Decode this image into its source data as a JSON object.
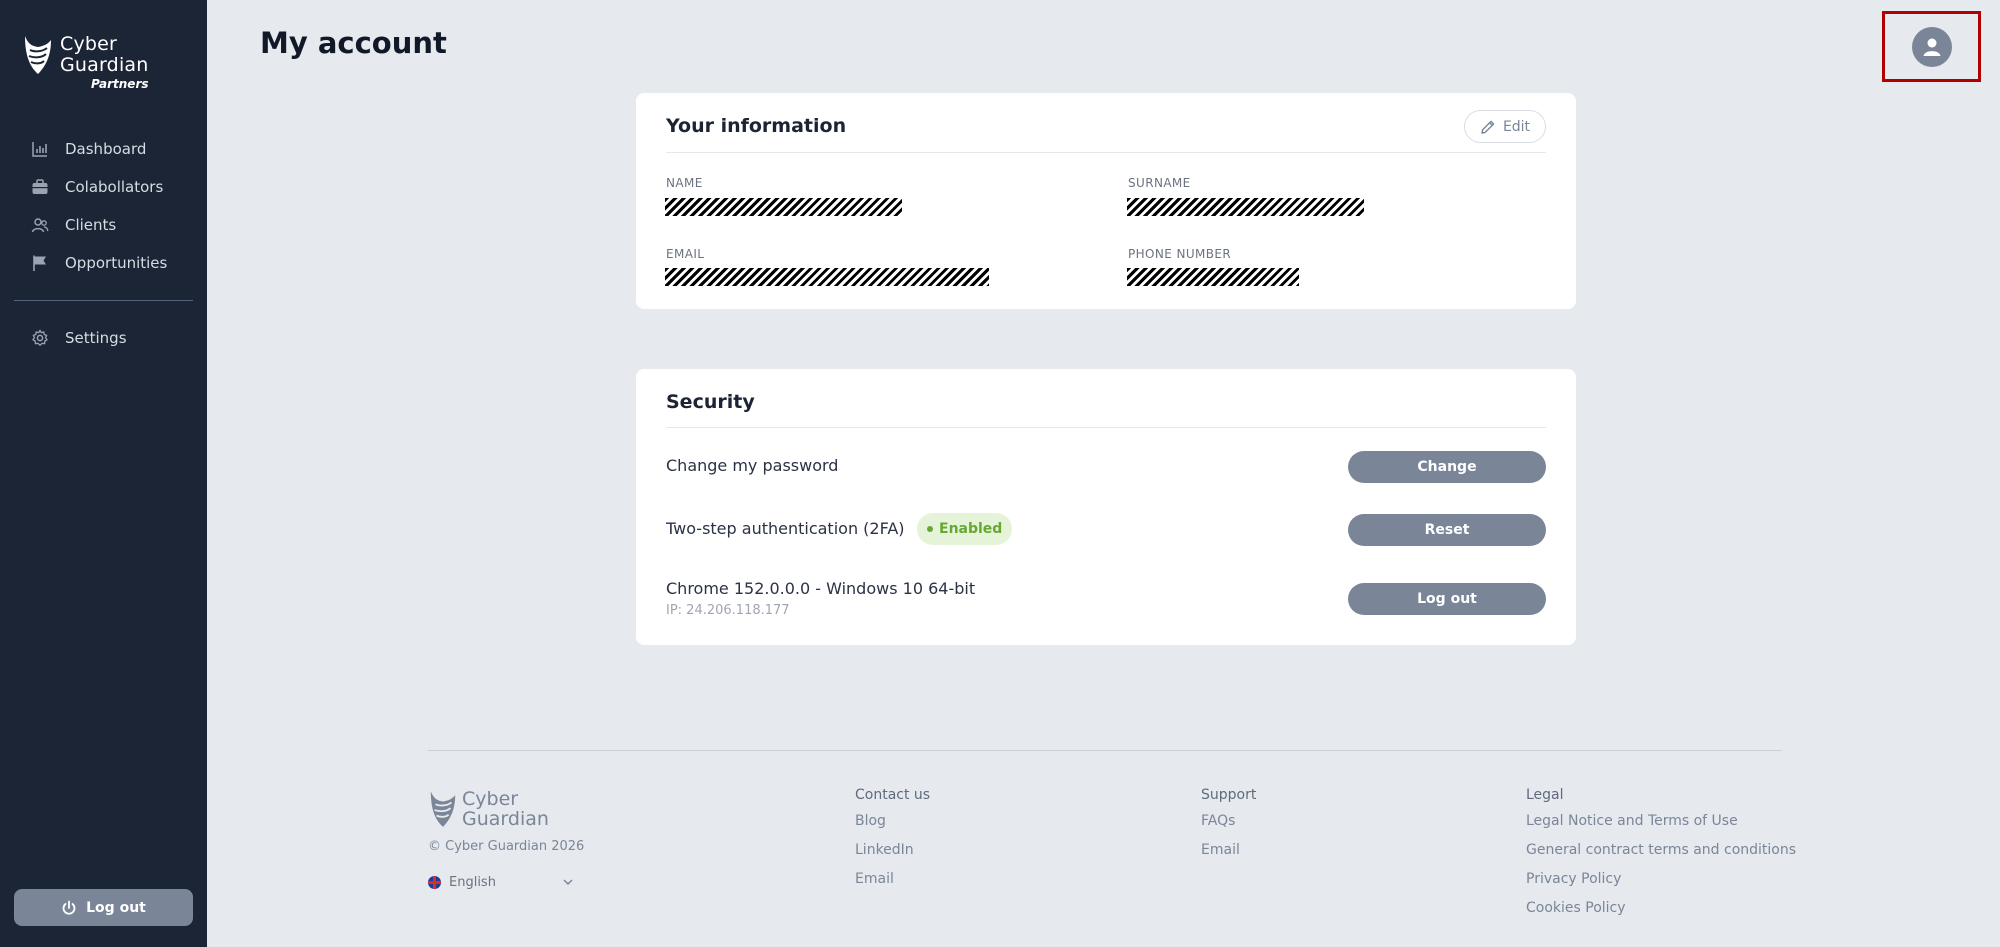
{
  "app": {
    "brand_line1": "Cyber",
    "brand_line2": "Guardian",
    "brand_tag": "Partners"
  },
  "sidebar": {
    "items": [
      {
        "label": "Dashboard",
        "icon": "bar-chart-icon"
      },
      {
        "label": "Colabollators",
        "icon": "briefcase-icon"
      },
      {
        "label": "Clients",
        "icon": "users-icon"
      },
      {
        "label": "Opportunities",
        "icon": "flag-icon"
      }
    ],
    "settings": {
      "label": "Settings",
      "icon": "gear-icon"
    },
    "logout_label": "Log out"
  },
  "header": {
    "title": "My account",
    "avatar_icon": "user-icon"
  },
  "info_card": {
    "title": "Your information",
    "edit_label": "Edit",
    "fields": {
      "name_label": "NAME",
      "surname_label": "SURNAME",
      "email_label": "EMAIL",
      "phone_label": "PHONE NUMBER"
    }
  },
  "security_card": {
    "title": "Security",
    "password": {
      "label": "Change my password",
      "button": "Change"
    },
    "twofa": {
      "label": "Two-step authentication (2FA)",
      "badge": "Enabled",
      "button": "Reset"
    },
    "session": {
      "label": "Chrome 152.0.0.0 - Windows 10 64-bit",
      "ip": "IP: 24.206.118.177",
      "button": "Log out"
    }
  },
  "footer": {
    "brand_line1": "Cyber",
    "brand_line2": "Guardian",
    "copyright": "© Cyber Guardian 2026",
    "language": "English",
    "contact": {
      "heading": "Contact us",
      "links": [
        "Blog",
        "LinkedIn",
        "Email"
      ]
    },
    "support": {
      "heading": "Support",
      "links": [
        "FAQs",
        "Email"
      ]
    },
    "legal": {
      "heading": "Legal",
      "links": [
        "Legal Notice and Terms of Use",
        "General contract terms and conditions",
        "Privacy Policy",
        "Cookies Policy"
      ]
    }
  },
  "colors": {
    "sidebar_bg": "#1c2535",
    "page_bg": "#e6e9ee",
    "button_gray": "#7a8698",
    "badge_green": "#66a832",
    "highlight_red": "#b10000"
  }
}
